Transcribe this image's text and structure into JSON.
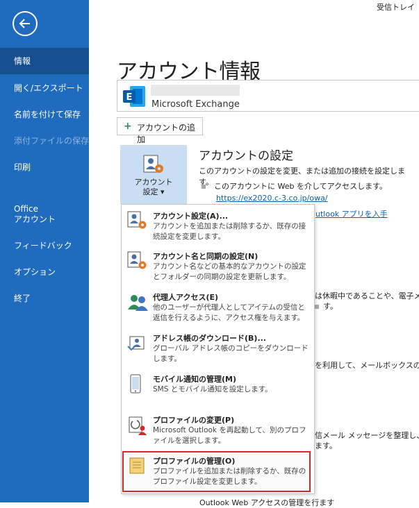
{
  "top_right": "受信トレイ",
  "sidebar": {
    "items": [
      {
        "label": "情報"
      },
      {
        "label": "開く/エクスポート"
      },
      {
        "label": "名前を付けて保存"
      },
      {
        "label": "添付ファイルの保存"
      },
      {
        "label": "印刷"
      },
      {
        "label": "Office"
      },
      {
        "label": "アカウント"
      },
      {
        "label": "フィードバック"
      },
      {
        "label": "オプション"
      },
      {
        "label": "終了"
      }
    ]
  },
  "main": {
    "title": "アカウント情報",
    "account_type": "Microsoft Exchange",
    "add_account": "アカウントの追加",
    "settings_button": {
      "line1": "アカウント",
      "line2": "設定 ▾"
    },
    "section_title": "アカウントの設定",
    "section_desc": "このアカウントの設定を変更、または追加の接続を設定します。",
    "bullet_web": "このアカウントに Web を介してアクセスします。",
    "owa_link": "https://ex2020.c-3.co.jp/owa/",
    "outlook_app_link": "utlook アプリを入手",
    "bg_vacation": "は休暇中であることや、電子メ",
    "bg_vacation2": "す。",
    "bg_mailbox": "を利用して、メールボックスのサ",
    "bg_cleanup": "信メール メッセージを整理し、ア",
    "bg_cleanup2": "ます。",
    "bg_bottom": "Outlook Web アクセスの管理を行ます"
  },
  "menu": {
    "items": [
      {
        "title": "アカウント設定(A)...",
        "desc": "アカウントを追加または削除するか、既存の接続設定を変更します。"
      },
      {
        "title": "アカウント名と同期の設定(N)",
        "desc": "アカウント名などの基本的なアカウントの設定とフォルダーの同期の設定を更新します。"
      },
      {
        "title": "代理人アクセス(E)",
        "desc": "他のユーザーが代理人としてアイテムの受信と返信を行えるように、アクセス権を与えます。"
      },
      {
        "title": "アドレス帳のダウンロード(B)...",
        "desc": "グローバル アドレス帳のコピーをダウンロードします。"
      },
      {
        "title": "モバイル通知の管理(M)",
        "desc": "SMS とモバイル通知を設定します。"
      },
      {
        "title": "プロファイルの変更(P)",
        "desc": "Microsoft Outlook を再起動して、別のプロファイルを選択します。"
      },
      {
        "title": "プロファイルの管理(O)",
        "desc": "プロファイルを追加または削除するか、既存のプロファイル設定を変更します。"
      }
    ]
  },
  "colors": {
    "sidebar": "#1f6bbd",
    "sidebar_active": "#154f8f",
    "highlight_border": "#d9262c",
    "link": "#0b5fb0"
  }
}
